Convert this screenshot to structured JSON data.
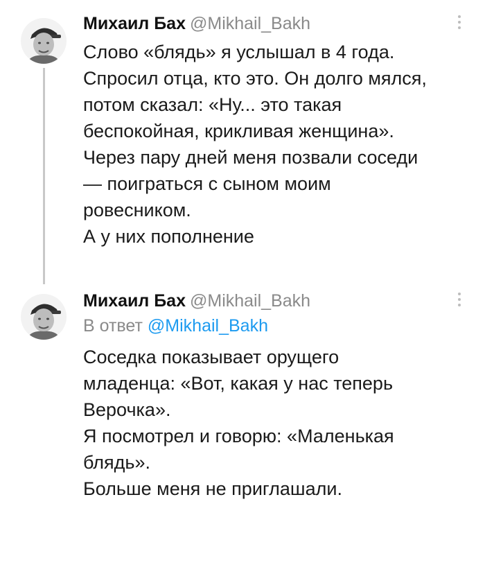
{
  "tweets": [
    {
      "author_name": "Михаил Бах",
      "author_handle": "@Mikhail_Bakh",
      "avatar_icon": "user-avatar",
      "more_icon": "more-options-icon",
      "lines": [
        "Слово «блядь» я услышал в 4 года.",
        "Спросил отца, кто это. Он долго мялся,",
        "потом сказал: «Ну... это такая",
        "беспокойная, крикливая женщина».",
        "Через пару дней меня позвали соседи",
        "— поиграться с сыном моим",
        "ровесником.",
        "А у них пополнение"
      ]
    },
    {
      "author_name": "Михаил Бах",
      "author_handle": "@Mikhail_Bakh",
      "avatar_icon": "user-avatar",
      "more_icon": "more-options-icon",
      "reply_prefix": "В ответ",
      "reply_mention": "@Mikhail_Bakh",
      "lines": [
        "Соседка показывает орущего",
        "младенца: «Вот, какая у нас теперь",
        "Верочка».",
        "Я посмотрел и говорю: «Маленькая",
        "блядь».",
        "Больше меня не приглашали."
      ]
    }
  ],
  "colors": {
    "text": "#111111",
    "secondary": "#8a8a8a",
    "link": "#1d9bf0",
    "thread_line": "#c8c8c8"
  }
}
